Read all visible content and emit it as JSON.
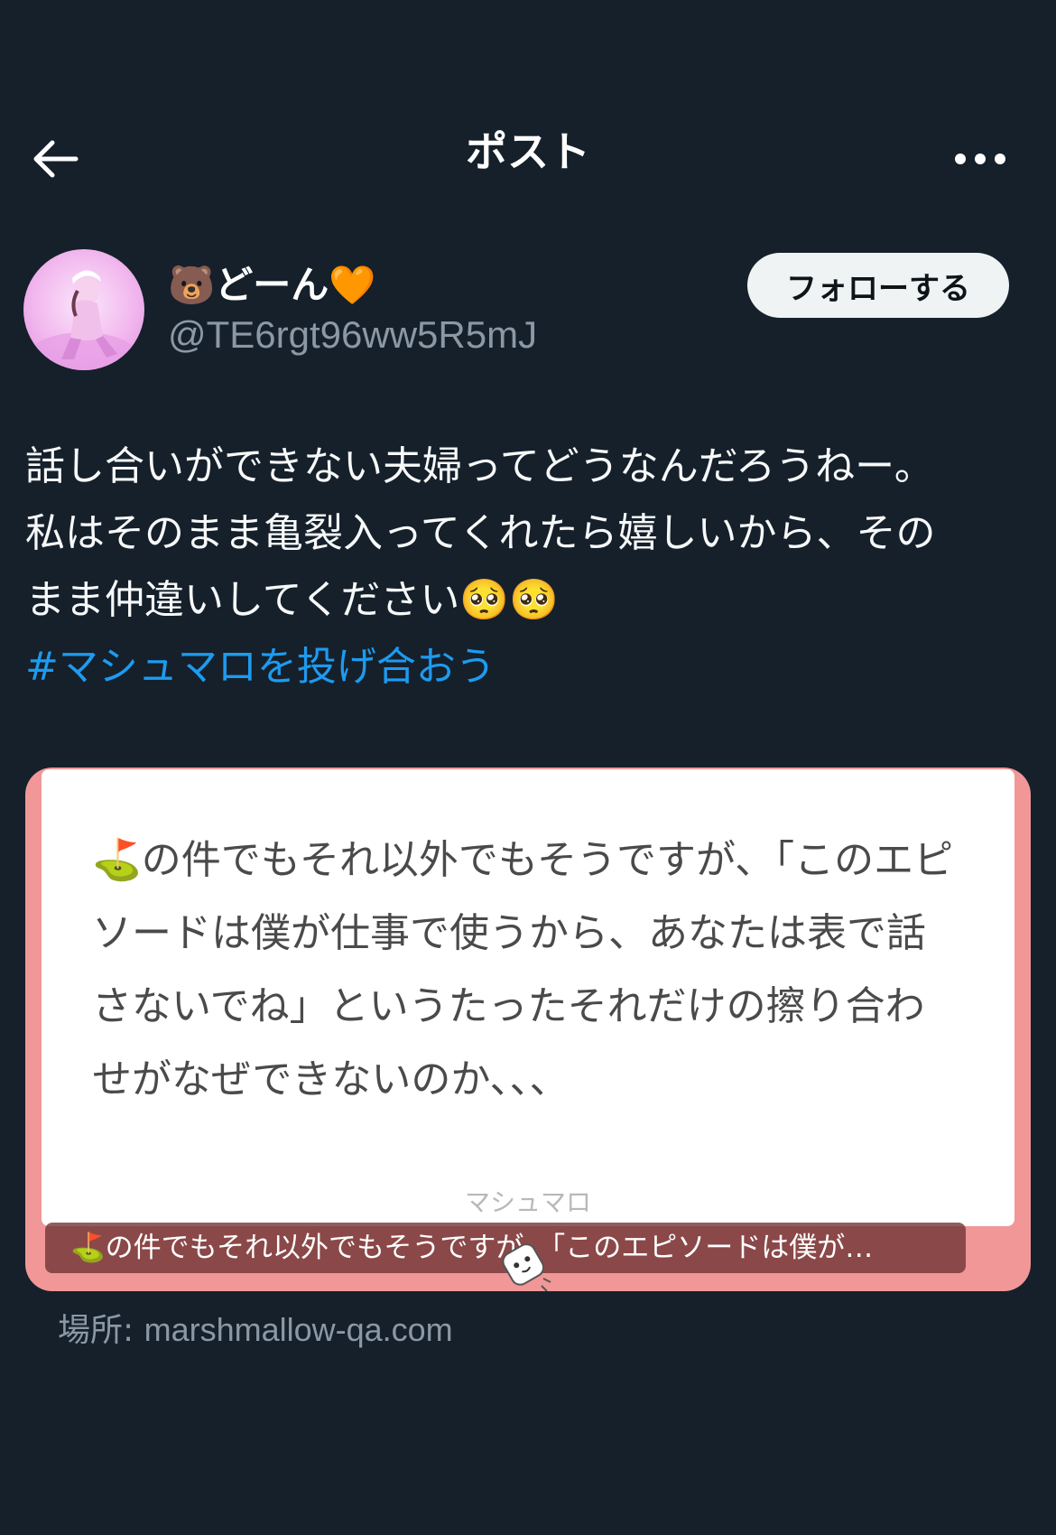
{
  "header": {
    "title": "ポスト",
    "back_icon": "arrow-left-icon",
    "more_icon": "more-horizontal-icon"
  },
  "author": {
    "name_prefix_emoji": "🐻",
    "name": "どーん",
    "name_suffix_emoji": "🧡",
    "handle": "@TE6rgt96ww5R5mJ",
    "follow_label": "フォローする"
  },
  "post": {
    "lines": [
      "話し合いができない夫婦ってどうなんだろうねー。",
      "私はそのまま亀裂入ってくれたら嬉しいから、その",
      "まま仲違いしてください🥺🥺"
    ],
    "hashtag": "#マシュマロを投げ合おう"
  },
  "card": {
    "question_lines": [
      "⛳の件でもそれ以外でもそうですが、「このエピ",
      "ソードは僕が仕事で使うから、あなたは表で話",
      "さないでね」というたったそれだけの擦り合わ",
      "せがなぜできないのか、、、"
    ],
    "brand": "マシュマロ",
    "caption": "⛳の件でもそれ以外でもそうですが、「このエピソードは僕が…",
    "mascot_icon": "marshmallow-mascot-icon"
  },
  "location": {
    "label": "場所: ",
    "url": "marshmallow-qa.com"
  },
  "colors": {
    "background": "#15202b",
    "accent": "#1d9bf0",
    "card_border": "#f19797",
    "secondary_text": "#8b98a5"
  }
}
